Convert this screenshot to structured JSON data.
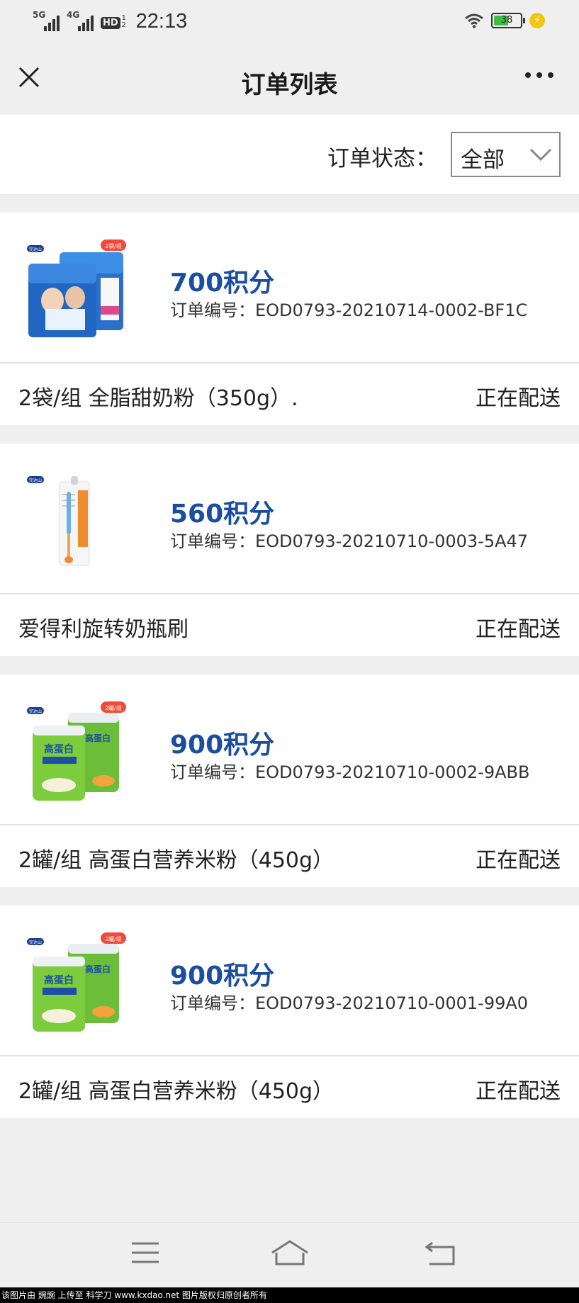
{
  "status_bar": {
    "sim1": "5G",
    "sim2": "4G",
    "hd": "HD",
    "hd_sub": "1 2",
    "time": "22:13",
    "battery": "38"
  },
  "navbar": {
    "title": "订单列表"
  },
  "filter": {
    "label": "订单状态：",
    "selected": "全部"
  },
  "orders": [
    {
      "points": "700积分",
      "order_no": "订单编号：EOD0793-20210714-0002-BF1C",
      "product": "2袋/组 全脂甜奶粉（350g）.",
      "status": "正在配送",
      "brand": "完达山",
      "badge": "2袋/组"
    },
    {
      "points": "560积分",
      "order_no": "订单编号：EOD0793-20210710-0003-5A47",
      "product": "爱得利旋转奶瓶刷",
      "status": "正在配送",
      "brand": "完达山",
      "badge": ""
    },
    {
      "points": "900积分",
      "order_no": "订单编号：EOD0793-20210710-0002-9ABB",
      "product": "2罐/组 高蛋白营养米粉（450g）",
      "status": "正在配送",
      "brand": "完达山",
      "badge": "2罐/组"
    },
    {
      "points": "900积分",
      "order_no": "订单编号：EOD0793-20210710-0001-99A0",
      "product": "2罐/组 高蛋白营养米粉（450g）",
      "status": "正在配送",
      "brand": "完达山",
      "badge": "2罐/组"
    }
  ],
  "watermark": "该图片由 豌豌 上传至 科学刀 www.kxdao.net 图片版权归原创者所有",
  "colors": {
    "points": "#1b4ea0",
    "background": "#efefef",
    "card": "#ffffff"
  }
}
